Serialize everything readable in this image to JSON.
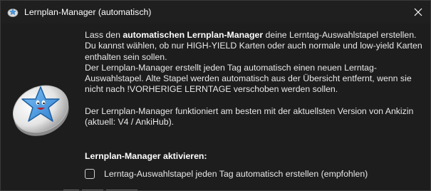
{
  "window": {
    "title": "Lernplan-Manager (automatisch)",
    "app_icon": "anki-star-icon",
    "close_icon": "close-icon"
  },
  "description": {
    "line1_pre": "Lass den ",
    "line1_bold": "automatischen Lernplan-Manager",
    "line1_post": " deine Lerntag-Auswahlstapel erstellen.",
    "line2": "Du kannst wählen, ob nur HIGH-YIELD Karten oder auch normale und low-yield Karten enthalten sein sollen.",
    "line3": "Der Lernplan-Manager erstellt jeden Tag automatisch einen neuen Lerntag-Auswahlstapel. Alte Stapel werden automatisch aus der Übersicht entfernt, wenn sie nicht nach !VORHERIGE LERNTAGE verschoben werden sollen.",
    "line4": "Der Lernplan-Manager funktioniert am besten mit der aktuellsten Version von Ankizin (aktuell: V4 / AnkiHub)."
  },
  "activation": {
    "section_title": "Lernplan-Manager aktivieren:",
    "checkbox_label": "Lerntag-Auswahlstapel jeden Tag automatisch erstellen (empfohlen)",
    "checked": false
  },
  "colors": {
    "background": "#1d1d1d",
    "text": "#e8e8e8",
    "star": "#4a9be0"
  }
}
